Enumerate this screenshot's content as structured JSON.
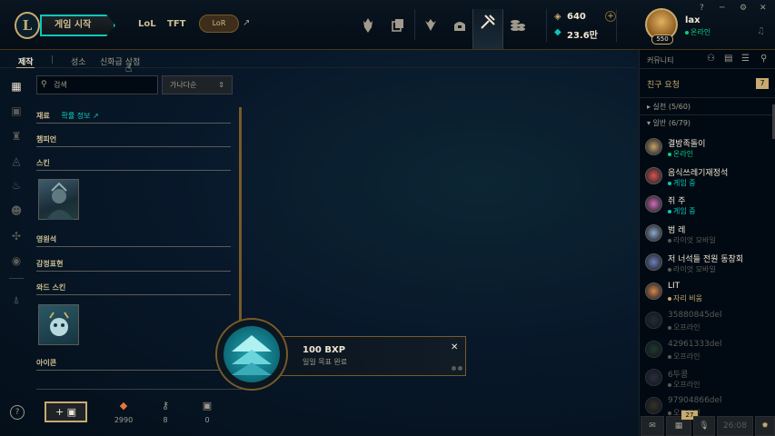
{
  "header": {
    "logo_letter": "L",
    "play_button": "게임 시작",
    "modes": [
      "LoL",
      "TFT"
    ],
    "lor_label": "LoR",
    "lor_arrow": "↗",
    "nav_icons": [
      "home-icon",
      "collection-icon",
      "tft-icon",
      "loot-icon",
      "store-icon",
      "hextech-icon"
    ],
    "rp": "640",
    "be": "23.6만",
    "profile": {
      "name": "lax",
      "status": "온라인",
      "level": "550"
    },
    "window_controls": {
      "help": "?",
      "minimize": "─",
      "close": "✕"
    }
  },
  "left_nav": {
    "icons": [
      "grid-icon",
      "chest-icon",
      "champion-icon",
      "skin-icon",
      "fire-icon",
      "emote-icon",
      "ward-icon",
      "user-icon",
      "ward-skin-icon"
    ]
  },
  "tabs": {
    "items": [
      "제작",
      "성소",
      "신화급 상점"
    ],
    "active": 0
  },
  "loot": {
    "search_placeholder": "검색",
    "sort": "가나다순",
    "materials_label": "재료",
    "drop_rate_link": "확률 정보",
    "sections": [
      "챔피언",
      "스킨",
      "영원석",
      "감정표현",
      "와드 스킨",
      "아이콘"
    ]
  },
  "bottom": {
    "help": "?",
    "add_chest": "+",
    "currencies": [
      {
        "icon": "orange-essence-icon",
        "value": "2990"
      },
      {
        "icon": "key-icon",
        "value": "8"
      },
      {
        "icon": "chest-icon",
        "value": "0"
      }
    ]
  },
  "notification": {
    "title": "100 BXP",
    "subtitle": "일일 목표 완료",
    "close": "✕"
  },
  "social": {
    "title": "커뮤니티",
    "friend_requests_label": "친구 요청",
    "friend_requests_count": "7",
    "groups": [
      {
        "name": "▸ 실천 (5/60)"
      },
      {
        "name": "▾ 일반 (6/79)"
      }
    ],
    "friends": [
      {
        "name": "결방족돌이",
        "status": "온라인",
        "status_color": "#0acf83",
        "avatar": "#c7a06a"
      },
      {
        "name": "음식쓰레기재정석",
        "status": "게임 중",
        "status_color": "#0ac8b9",
        "avatar": "#d9534f"
      },
      {
        "name": "쥐 주",
        "status": "게임 중",
        "status_color": "#0ac8b9",
        "avatar": "#d06bb5"
      },
      {
        "name": "범 레",
        "status": "라이엇 모바일",
        "status_color": "#5b5a56",
        "avatar": "#8ea6c8"
      },
      {
        "name": "저 너석들 전원 동창회",
        "status": "라이엇 모바일",
        "status_color": "#5b5a56",
        "avatar": "#6f7fb8"
      },
      {
        "name": "LIT",
        "status": "자리 비움",
        "status_color": "#c8aa6e",
        "avatar": "#d6874a"
      },
      {
        "name": "35880845del",
        "status": "오프라인",
        "status_color": "#5b5a56",
        "avatar": "#4a4f5a"
      },
      {
        "name": "42961333del",
        "status": "오프라인",
        "status_color": "#5b5a56",
        "avatar": "#3e6a4a"
      },
      {
        "name": "6두콩",
        "status": "오프라인",
        "status_color": "#5b5a56",
        "avatar": "#5a5070"
      },
      {
        "name": "97904866del",
        "status": "오프라인",
        "status_color": "#5b5a56",
        "avatar": "#6a5a40"
      }
    ],
    "bottom_bar": {
      "time": "26:08",
      "badge": "27"
    }
  }
}
